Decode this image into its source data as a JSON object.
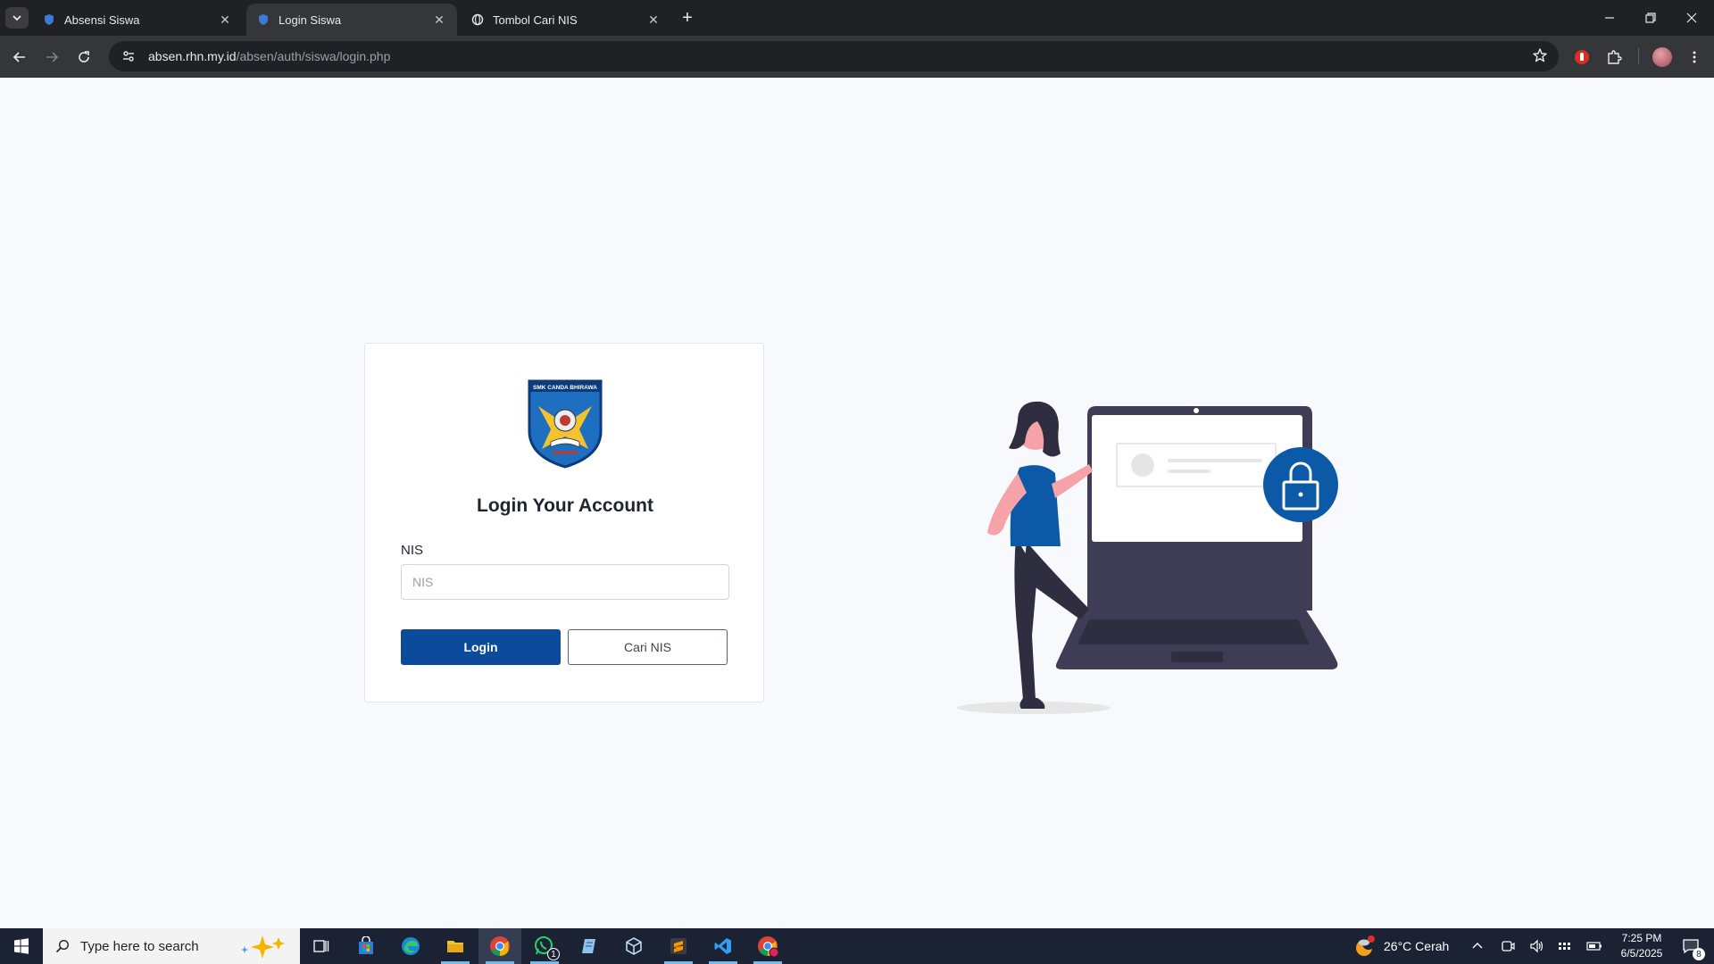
{
  "browser": {
    "tabs": [
      {
        "label": "Absensi Siswa",
        "active": false
      },
      {
        "label": "Login Siswa",
        "active": true
      },
      {
        "label": "Tombol Cari NIS",
        "active": false
      }
    ],
    "url_host": "absen.rhn.my.id",
    "url_path": "/absen/auth/siswa/login.php"
  },
  "login": {
    "logo_text": "SMK CANDA BHIRAWA",
    "title": "Login Your Account",
    "nis_label": "NIS",
    "nis_placeholder": "NIS",
    "nis_value": "",
    "login_button": "Login",
    "cari_button": "Cari NIS"
  },
  "colors": {
    "primary": "#0c4b9c",
    "page_bg": "#f8f9fc",
    "illustration_dark": "#3f3d56",
    "illustration_accent": "#0c59a8"
  },
  "taskbar": {
    "search_placeholder": "Type here to search",
    "weather": "26°C  Cerah",
    "time": "7:25 PM",
    "date": "6/5/2025",
    "notification_count": "8",
    "whatsapp_badge": "1"
  }
}
